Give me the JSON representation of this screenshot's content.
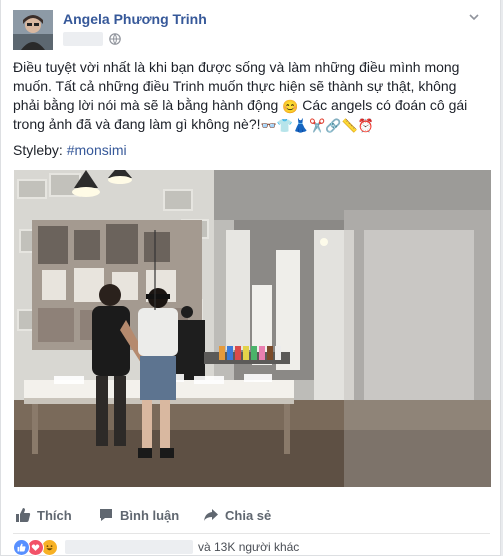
{
  "post": {
    "author": "Angela Phương Trinh",
    "text_line1": "Điều tuyệt vời nhất là khi bạn được sống và làm những điều mình mong",
    "text_line2": "muốn. Tất cả những điều Trinh muốn thực hiện sẽ thành sự thật, không",
    "text_line3_before": "phải bằng lời nói mà sẽ là bằng hành động",
    "text_line3_after": " Các angels có đoán cô gái",
    "text_line4": "trong ảnh đã và đang làm gì không nè?!",
    "styleby_label": "Styleby: ",
    "hashtag": "#monsimi"
  },
  "actions": {
    "like": "Thích",
    "comment": "Bình luận",
    "share": "Chia sẻ"
  },
  "reactions": {
    "summary": "và 13K người khác"
  },
  "icons": {
    "privacy": "globe-icon",
    "menu": "chevron-down-icon",
    "like": "thumbs-up-icon",
    "comment": "comment-icon",
    "share": "share-arrow-icon"
  },
  "colors": {
    "link": "#365899",
    "like_blue": "#5890ff",
    "love_red": "#f25268",
    "haha_yellow": "#f7b125"
  }
}
